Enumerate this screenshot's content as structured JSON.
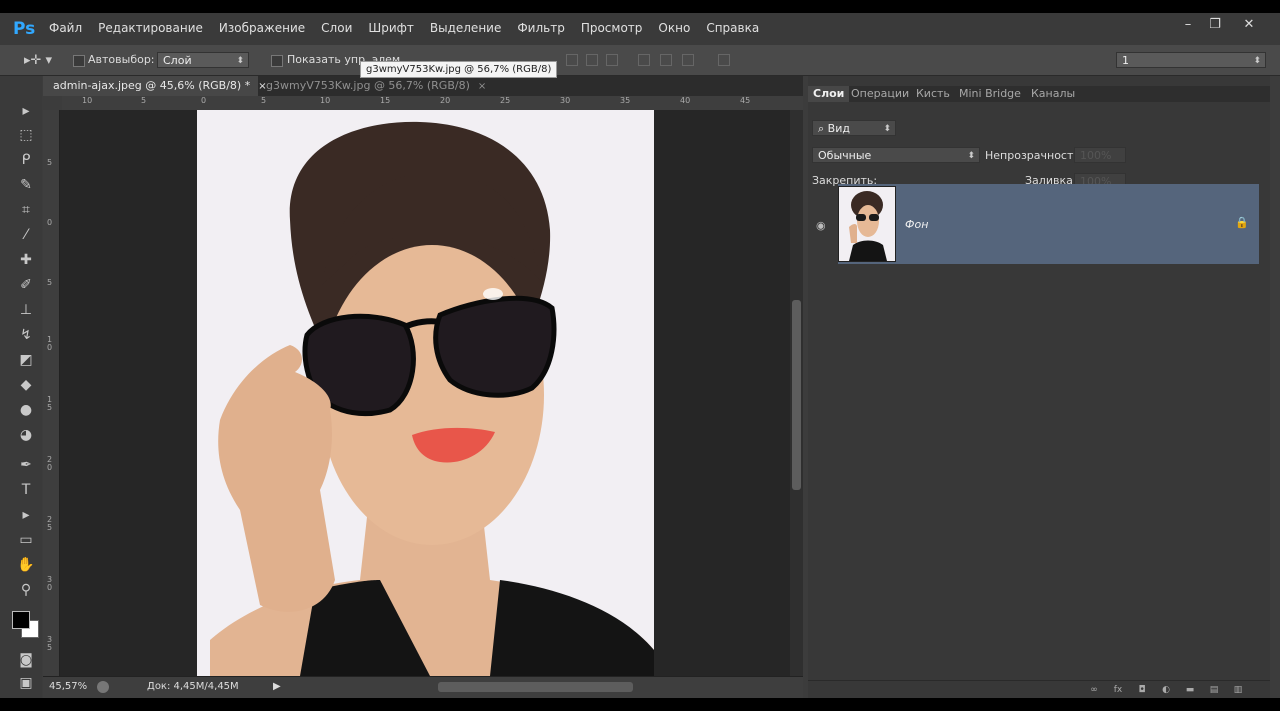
{
  "app": {
    "logo": "Ps"
  },
  "menu": [
    "Файл",
    "Редактирование",
    "Изображение",
    "Слои",
    "Шрифт",
    "Выделение",
    "Фильтр",
    "Просмотр",
    "Окно",
    "Справка"
  ],
  "window_controls": {
    "minimize": "–",
    "restore": "❐",
    "close": "✕"
  },
  "options": {
    "autoselect_label": "Автовыбор:",
    "autoselect_value": "Слой",
    "show_controls_label": "Показать упр. элем.",
    "workspace_value": "1"
  },
  "tabs": [
    {
      "label": "admin-ajax.jpeg @ 45,6% (RGB/8) *",
      "close": "×"
    },
    {
      "label": "g3wmyV753Kw.jpg @ 56,7% (RGB/8)",
      "close": "×"
    }
  ],
  "tooltip": "g3wmyV753Kw.jpg @ 56,7% (RGB/8)",
  "ruler_h": [
    "10",
    "5",
    "0",
    "5",
    "10",
    "15",
    "20",
    "25",
    "30",
    "35",
    "40",
    "45"
  ],
  "ruler_v": [
    "5",
    "0",
    "5",
    "1\n0",
    "1\n5",
    "2\n0",
    "2\n5",
    "3\n0",
    "3\n5",
    "4\n0",
    "4\n5"
  ],
  "status": {
    "zoom": "45,57%",
    "doc": "Док: 4,45M/4,45M"
  },
  "panel": {
    "tabs": [
      "Слои",
      "Операции",
      "Кисть",
      "Mini Bridge",
      "Каналы"
    ],
    "filter_value": "Вид",
    "blend_mode": "Обычные",
    "opacity_label": "Непрозрачность:",
    "opacity_value": "100%",
    "lock_label": "Закрепить:",
    "fill_label": "Заливка:",
    "fill_value": "100%",
    "layers": [
      {
        "name": "Фон"
      }
    ]
  },
  "colors": {
    "accent_logo": "#31a8ff",
    "selected_layer": "#55657c",
    "panel_bg": "#383838"
  }
}
